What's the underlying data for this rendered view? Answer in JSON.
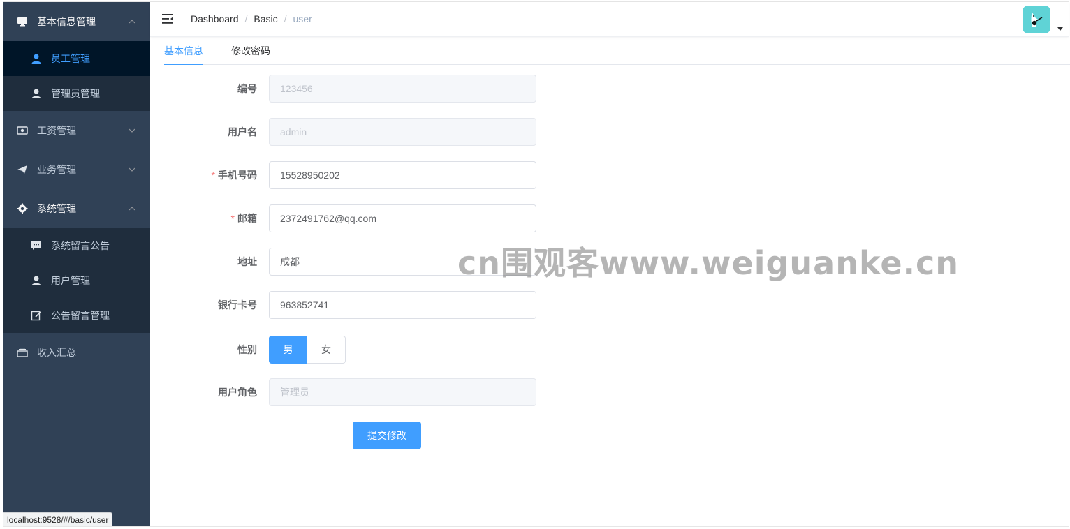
{
  "sidebar": {
    "menus": [
      {
        "label": "基本信息管理",
        "icon": "monitor-icon",
        "open": true,
        "children": [
          {
            "label": "员工管理",
            "icon": "user-icon",
            "active": true
          },
          {
            "label": "管理员管理",
            "icon": "user-icon",
            "active": false
          }
        ]
      },
      {
        "label": "工资管理",
        "icon": "money-icon",
        "open": false
      },
      {
        "label": "业务管理",
        "icon": "paper-plane-icon",
        "open": false
      },
      {
        "label": "系统管理",
        "icon": "gear-icon",
        "open": true,
        "children": [
          {
            "label": "系统留言公告",
            "icon": "message-icon"
          },
          {
            "label": "用户管理",
            "icon": "user-icon"
          },
          {
            "label": "公告留言管理",
            "icon": "edit-icon"
          }
        ]
      },
      {
        "label": "收入汇总",
        "icon": "tray-icon",
        "open": false
      }
    ]
  },
  "navbar": {
    "breadcrumb": [
      "Dashboard",
      "Basic",
      "user"
    ]
  },
  "tabs": [
    {
      "label": "基本信息",
      "active": true
    },
    {
      "label": "修改密码",
      "active": false
    }
  ],
  "form": {
    "id": {
      "label": "编号",
      "value": "123456",
      "required": false
    },
    "username": {
      "label": "用户名",
      "value": "admin",
      "required": false
    },
    "phone": {
      "label": "手机号码",
      "value": "15528950202",
      "required": true
    },
    "email": {
      "label": "邮箱",
      "value": "2372491762@qq.com",
      "required": true
    },
    "address": {
      "label": "地址",
      "value": "成都",
      "required": false
    },
    "bank_card": {
      "label": "银行卡号",
      "value": "963852741",
      "required": false
    },
    "gender": {
      "label": "性别",
      "options": [
        "男",
        "女"
      ],
      "selected": "男"
    },
    "role": {
      "label": "用户角色",
      "value": "管理员",
      "required": false
    },
    "submit_label": "提交修改"
  },
  "watermark": "cn围观客www.weiguanke.cn",
  "status_url": "localhost:9528/#/basic/user",
  "colors": {
    "sidebar_bg": "#304156",
    "submenu_bg": "#1f2d3d",
    "active_bg": "#001528",
    "accent": "#409eff",
    "required": "#f56c6c"
  }
}
